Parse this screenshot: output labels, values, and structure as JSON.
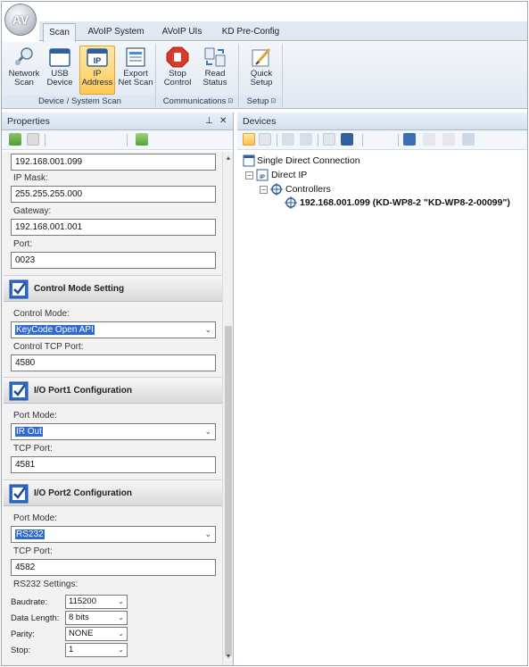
{
  "ribbon": {
    "orb_label": "AV",
    "tabs": [
      {
        "label": "Scan"
      },
      {
        "label": "AVoIP System"
      },
      {
        "label": "AVoIP UIs"
      },
      {
        "label": "KD Pre-Config"
      }
    ],
    "groups": [
      {
        "caption": "Device / System Scan"
      },
      {
        "caption": "Communications"
      },
      {
        "caption": "Setup"
      }
    ],
    "buttons": {
      "network_scan": {
        "line1": "Network",
        "line2": "Scan"
      },
      "usb_device": {
        "line1": "USB",
        "line2": "Device",
        "badge": "USB"
      },
      "ip_address": {
        "line1": "IP",
        "line2": "Address",
        "badge": "IP"
      },
      "export_net_scan": {
        "line1": "Export",
        "line2": "Net Scan"
      },
      "stop_control": {
        "line1": "Stop",
        "line2": "Control"
      },
      "read_status": {
        "line1": "Read",
        "line2": "Status"
      },
      "quick_setup": {
        "line1": "Quick",
        "line2": "Setup"
      }
    },
    "launcher_glyph": "⊡"
  },
  "properties": {
    "title": "Properties",
    "pin_glyph": "▾ ⊥",
    "close_glyph": "✕",
    "ip_value": "192.168.001.099",
    "ip_mask_label": "IP Mask:",
    "ip_mask_value": "255.255.255.000",
    "gateway_label": "Gateway:",
    "gateway_value": "192.168.001.001",
    "port_label": "Port:",
    "port_value": "0023",
    "control_mode_section": "Control Mode Setting",
    "control_mode_label": "Control Mode:",
    "control_mode_value": "KeyCode Open API",
    "control_tcp_label": "Control TCP Port:",
    "control_tcp_value": "4580",
    "io1_section": "I/O Port1 Configuration",
    "io1_mode_label": "Port Mode:",
    "io1_mode_value": "IR Out",
    "io1_tcp_label": "TCP Port:",
    "io1_tcp_value": "4581",
    "io2_section": "I/O Port2 Configuration",
    "io2_mode_label": "Port Mode:",
    "io2_mode_value": "RS232",
    "io2_tcp_label": "TCP Port:",
    "io2_tcp_value": "4582",
    "rs232_label": "RS232 Settings:",
    "baudrate_label": "Baudrate:",
    "baudrate_value": "115200",
    "data_length_label": "Data Length:",
    "data_length_value": "8 bits",
    "parity_label": "Parity:",
    "parity_value": "NONE",
    "stop_label": "Stop:",
    "stop_value": "1",
    "chevron": "⌄"
  },
  "devices": {
    "title": "Devices",
    "tree": {
      "root": "Single Direct Connection",
      "direct_ip": "Direct IP",
      "controllers": "Controllers",
      "device": "192.168.001.099 (KD-WP8-2 \"KD-WP8-2-00099\")",
      "collapse_glyph": "−"
    }
  },
  "colors": {
    "accent": "#2f6ad0",
    "selected_button": "#ffc95a",
    "pane_header": "#d5e0ee"
  }
}
